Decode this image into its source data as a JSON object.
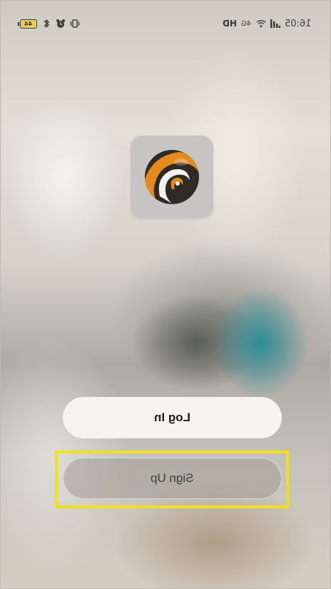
{
  "status_bar": {
    "time": "16:05",
    "battery_level": "44",
    "signal_label": "4G",
    "hd_label": "HD",
    "icons": [
      "battery-icon",
      "bluetooth-icon",
      "alarm-icon",
      "vibrate-icon",
      "wifi-icon",
      "signal-icon"
    ]
  },
  "logo": {
    "name": "app-logo",
    "colors": [
      "#2f2a26",
      "#e58a1e",
      "#ffffff"
    ]
  },
  "login_button": {
    "label": "Log In"
  },
  "signup_button": {
    "label": "Sign Up"
  },
  "highlight": {
    "color": "#eee21a",
    "target": "signup_button"
  }
}
